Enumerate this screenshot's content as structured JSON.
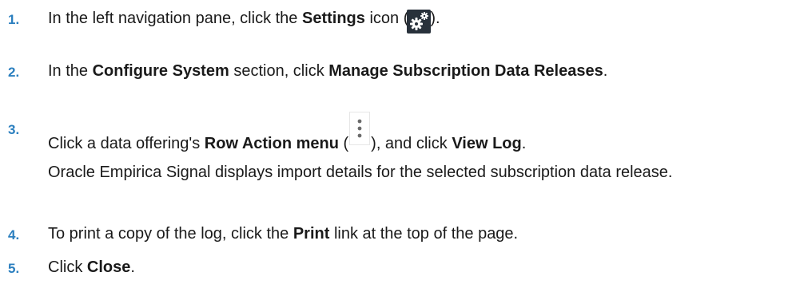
{
  "steps": [
    {
      "number": "1.",
      "parts": [
        "In the left navigation pane, click the ",
        "Settings",
        " icon (",
        ")."
      ]
    },
    {
      "number": "2.",
      "parts": [
        "In the ",
        "Configure System",
        " section, click ",
        "Manage Subscription Data Releases",
        "."
      ]
    },
    {
      "number": "3.",
      "parts": [
        "Click a data offering's ",
        "Row Action menu",
        " (",
        "), and click ",
        "View Log",
        "."
      ],
      "note": "Oracle Empirica Signal displays import details for the selected subscription data release."
    },
    {
      "number": "4.",
      "parts": [
        "To print a copy of the log, click the ",
        "Print",
        " link at the top of the page."
      ]
    },
    {
      "number": "5.",
      "parts": [
        "Click ",
        "Close",
        "."
      ]
    }
  ],
  "colors": {
    "step_number": "#2b7fbf",
    "text": "#1a1a1a",
    "icon_dark": "#28313b"
  },
  "icons": {
    "settings": "gear-icon",
    "row_action": "kebab-menu-icon"
  }
}
